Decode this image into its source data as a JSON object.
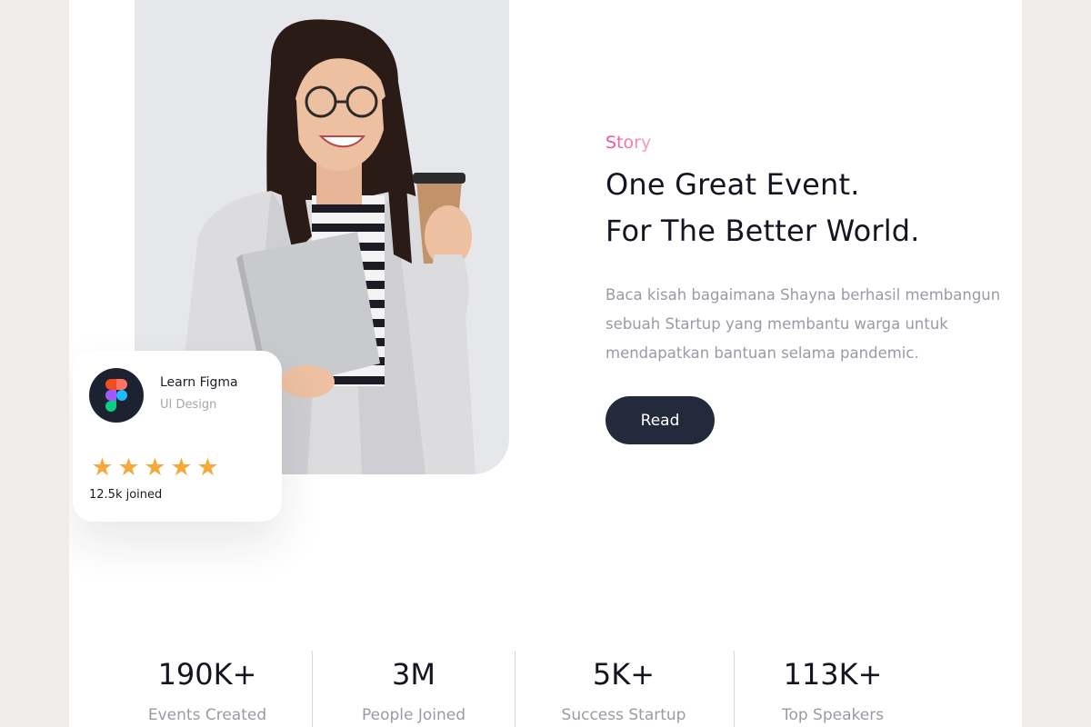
{
  "card": {
    "title": "Learn Figma",
    "subtitle": "UI Design",
    "icon": "figma-logo-icon",
    "rating": 5,
    "joined": "12.5k joined"
  },
  "story": {
    "label": "Story",
    "headline_line1": "One Great Event.",
    "headline_line2": "For The Better World.",
    "description_line1": "Baca kisah bagaimana Shayna berhasil membangun",
    "description_line2": "sebuah Startup yang membantu warga untuk",
    "description_line3": "mendapatkan bantuan selama pandemic.",
    "read_label": "Read"
  },
  "stats": [
    {
      "value": "190K+",
      "label": "Events Created"
    },
    {
      "value": "3M",
      "label": "People Joined"
    },
    {
      "value": "5K+",
      "label": "Success Startup"
    },
    {
      "value": "113K+",
      "label": "Top Speakers"
    }
  ],
  "colors": {
    "accent_pink": "#f1479a",
    "button_dark": "#232a3c",
    "star": "#f6a93b"
  }
}
